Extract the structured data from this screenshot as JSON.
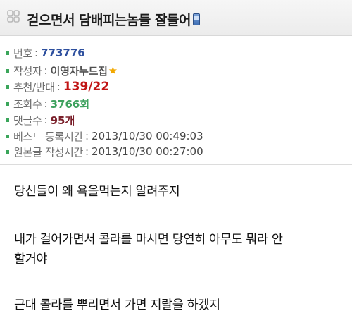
{
  "title": {
    "text": "걷으면서 담배피는놈들 잘들어",
    "icon": "clover-icon",
    "badge_icon": "phone-icon"
  },
  "info": {
    "number": {
      "label": "번호",
      "value": "773776"
    },
    "author": {
      "label": "작성자",
      "value": "이영자누드집",
      "star": "★"
    },
    "recommend": {
      "label": "추천/반대",
      "value": "139/22"
    },
    "views": {
      "label": "조회수",
      "value": "3766회"
    },
    "replies": {
      "label": "댓글수",
      "value": "95개"
    },
    "best_time": {
      "label": "베스트 등록시간",
      "value": "2013/10/30 00:49:03"
    },
    "original_time": {
      "label": "원본글 작성시간",
      "value": "2013/10/30 00:27:00"
    }
  },
  "body": {
    "lines": [
      "당신들이 왜 욕을먹는지 알려주지",
      "내가 걸어가면서 콜라를 마시면 당연히 아무도 뭐라 안",
      "할거야",
      "근대 콜라를 뿌리면서 가면 지랄을 하겠지"
    ]
  },
  "colors": {
    "bullet": "#3aa55a",
    "number": "#2d4f9e",
    "recommend": "#c11414",
    "views": "#3fa25f",
    "replies": "#7a1f2a",
    "star": "#f2a800"
  }
}
